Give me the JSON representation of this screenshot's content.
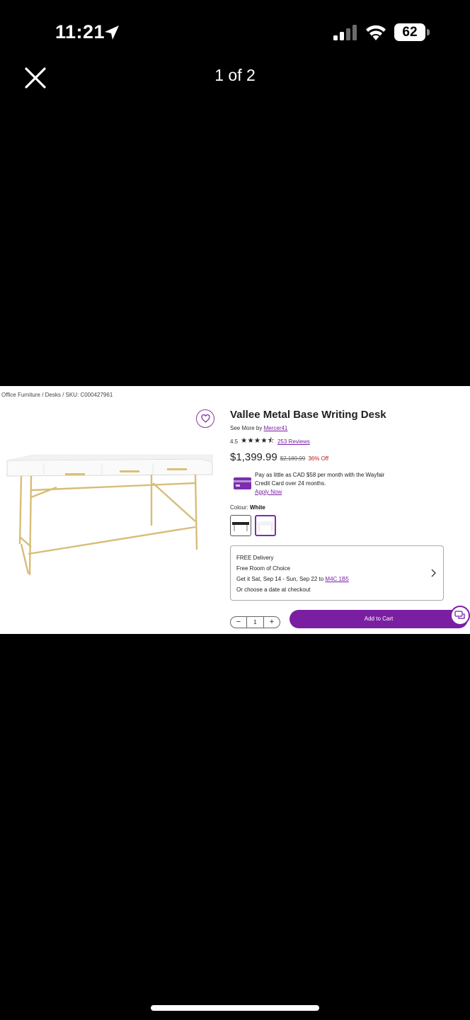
{
  "status_bar": {
    "time": "11:21",
    "battery": "62",
    "icons": [
      "location-arrow-icon",
      "cellular-signal-icon",
      "wifi-icon",
      "battery-icon"
    ]
  },
  "viewer": {
    "page_counter": "1 of 2",
    "close_icon": "close-icon"
  },
  "product_page": {
    "breadcrumb": "Office Furniture / Desks / SKU: C000427961",
    "title": "Vallee Metal Base Writing Desk",
    "see_more_prefix": "See More by",
    "brand": "Mercer41",
    "rating": "4.5",
    "stars": "★★★★⯪",
    "reviews": "253 Reviews",
    "price": "$1,399.99",
    "old_price": "$2,189.99",
    "discount": "36% Off",
    "pay_line1": "Pay as little as CAD $58 per month with the Wayfair",
    "pay_line2": "Credit Card over 24 months.",
    "apply_now": "Apply Now",
    "colour_label": "Colour:",
    "colour_value": "White",
    "delivery": {
      "line1": "FREE Delivery",
      "line2": "Free Room of Choice",
      "line3_prefix": "Get it Sat, Sep 14 - Sun, Sep 22 to",
      "postal_code": "M4C 1B5",
      "line4": "Or choose a date at checkout"
    },
    "quantity": "1",
    "qty_minus": "−",
    "qty_plus": "+",
    "add_to_cart": "Add to Cart",
    "colors": {
      "accent": "#7a1fa2",
      "discount": "#b3261e"
    }
  }
}
